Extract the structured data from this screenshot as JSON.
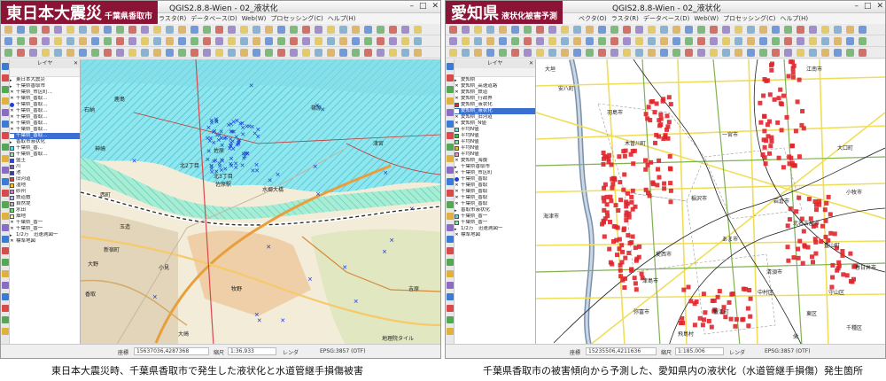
{
  "left": {
    "banner": {
      "main": "東日本大震災",
      "sub": "千葉県香取市"
    },
    "window_title": "QGIS2.8.8-Wien - 02_液状化",
    "menu": [
      "ラスタ(R)",
      "データベース(D)",
      "Web(W)",
      "プロセッシング(C)",
      "ヘルプ(H)"
    ],
    "layers_title": "レイヤ",
    "layers": [
      {
        "label": "東日本大震災",
        "sym": "none",
        "color": ""
      },
      {
        "label": "千葉県香取市",
        "sym": "none",
        "color": ""
      },
      {
        "label": "千葉県_市区町...",
        "sym": "x",
        "color": ""
      },
      {
        "label": "千葉県_香取...",
        "sym": "x",
        "color": ""
      },
      {
        "label": "千葉県_香取...",
        "sym": "dot",
        "color": "#1e3fd6"
      },
      {
        "label": "千葉県_香取...",
        "sym": "x",
        "color": ""
      },
      {
        "label": "千葉県_香取...",
        "sym": "x",
        "color": ""
      },
      {
        "label": "千葉県_香取...",
        "sym": "x",
        "color": ""
      },
      {
        "label": "千葉県_香取...",
        "sym": "x",
        "color": ""
      },
      {
        "label": "千葉県_香取...",
        "sym": "sel",
        "color": ""
      },
      {
        "label": "香取市液状化",
        "sym": "none",
        "color": ""
      },
      {
        "label": "千葉県_香...",
        "sym": "box",
        "color": "#62d6e6"
      },
      {
        "label": "千葉県_香取...",
        "sym": "box",
        "color": "#9ae0a8"
      },
      {
        "label": "盛土",
        "sym": "box",
        "color": "#2f3fd8"
      },
      {
        "label": "川",
        "sym": "box",
        "color": "#7a58c8"
      },
      {
        "label": "池",
        "sym": "box",
        "color": "#3a3aa0"
      },
      {
        "label": "旧河道",
        "sym": "box",
        "color": "#e33a3a"
      },
      {
        "label": "湿地",
        "sym": "box",
        "color": "#f0c23b"
      },
      {
        "label": "砂州",
        "sym": "box",
        "color": "#d877d6"
      },
      {
        "label": "鉄道敷",
        "sym": "box",
        "color": "#b9b9e6"
      },
      {
        "label": "自然堤",
        "sym": "box",
        "color": "#b6b6b6"
      },
      {
        "label": "水田",
        "sym": "box",
        "color": "#6fd06f"
      },
      {
        "label": "畑地",
        "sym": "box",
        "color": "#f4f4a0"
      },
      {
        "label": "千葉県_香一",
        "sym": "x",
        "color": ""
      },
      {
        "label": "千葉県_香一",
        "sym": "x",
        "color": ""
      },
      {
        "label": "1/2万　迅速測図一",
        "sym": "none",
        "color": ""
      },
      {
        "label": "標準地図",
        "sym": "x",
        "color": ""
      }
    ],
    "map_labels": {
      "kashima": "鹿島",
      "isshiba": "石納",
      "sakagawa": "佐原",
      "nishimachi": "西町",
      "mikawa": "神崎",
      "kitakyo": "北2丁目",
      "kitakyo2": "北3丁目",
      "tamatsukuri": "玉造",
      "shin_jukumachi": "新宿町",
      "oono": "大野",
      "ogeri": "小見",
      "suga": "香取",
      "makino": "牧野",
      "yoshihara": "吉原",
      "ohiko": "大崎",
      "tsukumi": "津宮",
      "sakagawa_station": "佐原駅",
      "bridge": "水郷大橋",
      "makino_label": "牧野",
      "tsunomiya": "津宮",
      "gencho": "篠原",
      "tile_credit": "地理院タイル"
    },
    "status": {
      "coord_label": "座標",
      "coord": "15637036,4287368",
      "scale_label": "縮尺",
      "scale": "1:36,933",
      "render": "レンダ",
      "crs": "EPSG:3857 (OTF)"
    }
  },
  "right": {
    "banner": {
      "main": "愛知県",
      "sub": "液状化被害予測"
    },
    "window_title": "QGIS2.8.8-Wien - 02_液状化",
    "menu": [
      "ベクタ(O)",
      "ラスタ(R)",
      "データベース(D)",
      "Web(W)",
      "プロセッシング(C)",
      "ヘルプ(H)"
    ],
    "layers_title": "レイヤ",
    "layers": [
      {
        "label": "愛知県",
        "sym": "none",
        "color": ""
      },
      {
        "label": "愛知県_高速道路",
        "sym": "x",
        "color": ""
      },
      {
        "label": "愛知県_鉄道",
        "sym": "x",
        "color": ""
      },
      {
        "label": "愛知県_行政界",
        "sym": "x",
        "color": ""
      },
      {
        "label": "愛知県_液状化",
        "sym": "box",
        "color": "#e22a2a"
      },
      {
        "label": "愛知県_液状化",
        "sym": "sel",
        "color": ""
      },
      {
        "label": "愛知県_旧河道",
        "sym": "x",
        "color": ""
      },
      {
        "label": "愛知県_N値",
        "sym": "x",
        "color": ""
      },
      {
        "label": "平均N値",
        "sym": "box",
        "color": "#5fe0f0"
      },
      {
        "label": "平均N値",
        "sym": "box",
        "color": "#48b848"
      },
      {
        "label": "平均N値",
        "sym": "box",
        "color": "#8fe08f"
      },
      {
        "label": "平均N値",
        "sym": "box",
        "color": "#e8b04a"
      },
      {
        "label": "平均N値",
        "sym": "box",
        "color": "#f08fd6"
      },
      {
        "label": "愛知県_海抜",
        "sym": "x",
        "color": ""
      },
      {
        "label": "千葉県香取市",
        "sym": "none",
        "color": ""
      },
      {
        "label": "千葉県_市区町",
        "sym": "x",
        "color": ""
      },
      {
        "label": "千葉県_香取",
        "sym": "dot",
        "color": "#1e3fd6"
      },
      {
        "label": "千葉県_香取",
        "sym": "x",
        "color": ""
      },
      {
        "label": "千葉県_香取",
        "sym": "x",
        "color": ""
      },
      {
        "label": "千葉県_香取",
        "sym": "x",
        "color": ""
      },
      {
        "label": "千葉県_香取",
        "sym": "x",
        "color": ""
      },
      {
        "label": "香取市液状化",
        "sym": "none",
        "color": ""
      },
      {
        "label": "千葉県_香一",
        "sym": "box",
        "color": "#62d6e6"
      },
      {
        "label": "千葉県_香一",
        "sym": "box",
        "color": "#9ae0a8"
      },
      {
        "label": "1/2万　迅速測図一",
        "sym": "none",
        "color": ""
      },
      {
        "label": "標準地図",
        "sym": "x",
        "color": ""
      }
    ],
    "map_labels": {
      "anpachi": "安八町",
      "hashima": "羽島市",
      "ichinomiya": "一宮市",
      "konan": "江南市",
      "kaizu": "海津市",
      "inazawa": "稲沢市",
      "iwakura": "岩倉市",
      "kitanagoya": "北名古屋市",
      "aisai": "愛西市",
      "tsushima": "津島市",
      "ama": "あま市",
      "kiyosu": "清須市",
      "komaki": "小牧市",
      "kasugai": "春日井市",
      "toyoyama": "豊山町",
      "nakamura": "中村区",
      "kanie": "蟹江町",
      "yatomi": "弥富市",
      "chikusa": "千種区",
      "kisogawa": "木曽川町",
      "ogaki": "大垣",
      "oguchi": "大口町",
      "tobishima": "飛島村",
      "moriyama": "守山区",
      "higashi": "東区",
      "sakae": "栄"
    },
    "status": {
      "coord_label": "座標",
      "coord": "15235506,4211636",
      "scale_label": "縮尺",
      "scale": "1:185,006",
      "render": "レンダ",
      "crs": "EPSG:3857 (OTF)"
    }
  },
  "captions": {
    "left": "東日本大震災時、千葉県香取市で発生した液状化と水道管継手損傷被害",
    "right": "千葉県香取市の被害傾向から予測した、愛知県内の液状化（水道管継手損傷）発生箇所"
  }
}
